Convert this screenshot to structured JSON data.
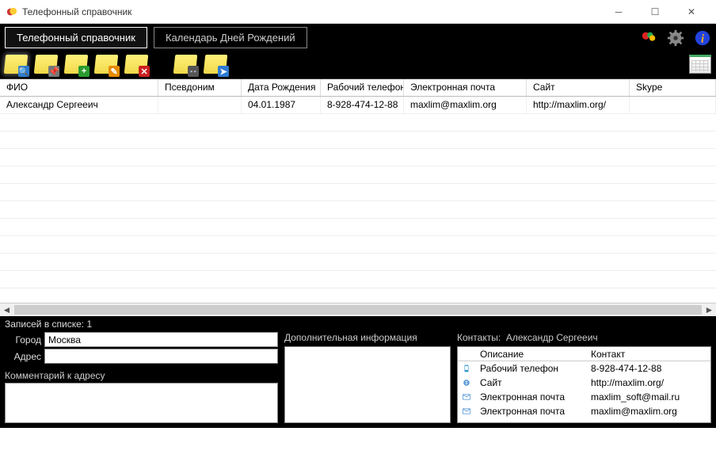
{
  "window": {
    "title": "Телефонный справочник"
  },
  "tabs": {
    "directory": "Телефонный справочник",
    "calendar": "Календарь Дней Рождений",
    "active": 0
  },
  "topicons": {
    "balloons": "balloons-icon",
    "gear": "gear-icon",
    "info": "info-icon"
  },
  "toolbar_icons": [
    "note-search",
    "note-pin",
    "note-add",
    "note-edit",
    "note-delete",
    "note-find",
    "note-export"
  ],
  "grid": {
    "columns": [
      "ФИО",
      "Псевдоним",
      "Дата Рождения",
      "Рабочий телефон",
      "Электронная почта",
      "Сайт",
      "Skype"
    ],
    "rows": [
      {
        "fio": "Александр Сергееич",
        "pseudonym": "",
        "dob": "04.01.1987",
        "workphone": "8-928-474-12-88",
        "email": "maxlim@maxlim.org",
        "site": "http://maxlim.org/",
        "skype": ""
      }
    ]
  },
  "count_label": "Записей в списке: 1",
  "form": {
    "city_label": "Город",
    "city_value": "Москва",
    "address_label": "Адрес",
    "address_value": "",
    "comment_label": "Комментарий к адресу"
  },
  "extra": {
    "title": "Дополнительная информация"
  },
  "contacts": {
    "title_prefix": "Контакты:",
    "name": "Александр Сергееич",
    "col_desc": "Описание",
    "col_contact": "Контакт",
    "rows": [
      {
        "icon": "phone-icon",
        "desc": "Рабочий телефон",
        "val": "8-928-474-12-88"
      },
      {
        "icon": "globe-icon",
        "desc": "Сайт",
        "val": "http://maxlim.org/"
      },
      {
        "icon": "mail-icon",
        "desc": "Электронная почта",
        "val": "maxlim_soft@mail.ru"
      },
      {
        "icon": "mail-icon",
        "desc": "Электронная почта",
        "val": "maxlim@maxlim.org"
      }
    ]
  }
}
